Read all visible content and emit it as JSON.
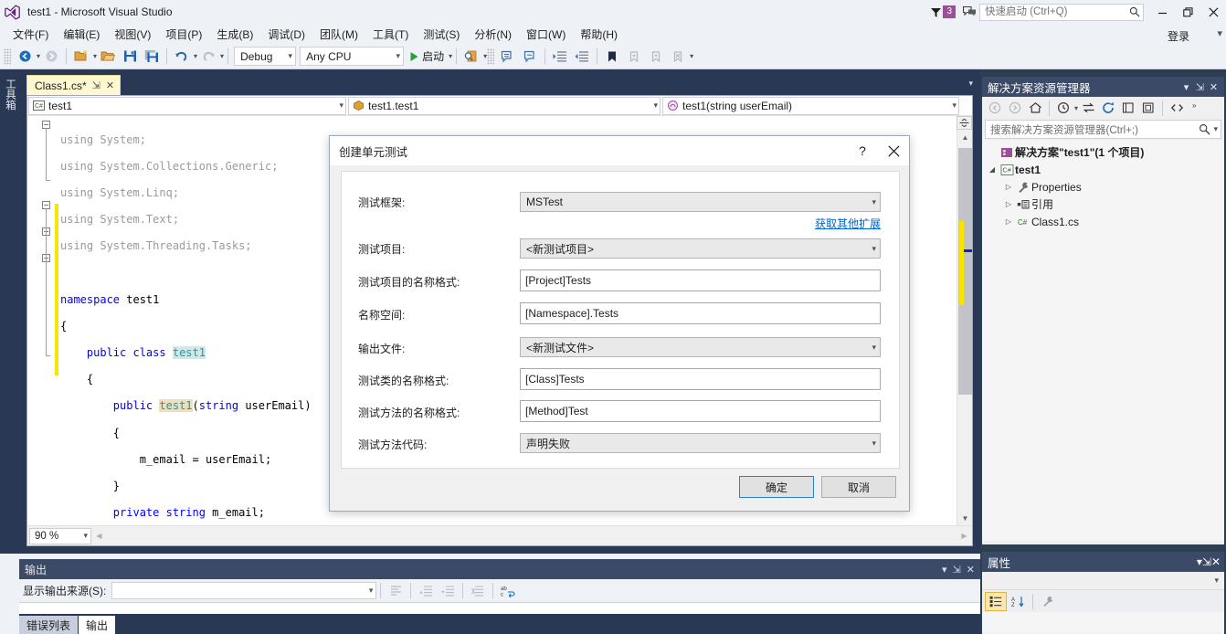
{
  "titlebar": {
    "title": "test1 - Microsoft Visual Studio",
    "logo_icon": "visual-studio-logo-icon",
    "notification_count": "3",
    "notification_icon": "notification-flag-icon",
    "feedback_icon": "feedback-icon",
    "quick_launch_placeholder": "快速启动 (Ctrl+Q)",
    "quick_launch_value": "",
    "search_icon": "search-icon",
    "minimize_icon": "minimize-icon",
    "restore_icon": "restore-icon",
    "close_icon": "close-icon"
  },
  "menubar": {
    "items": [
      {
        "label": "文件(F)"
      },
      {
        "label": "编辑(E)"
      },
      {
        "label": "视图(V)"
      },
      {
        "label": "项目(P)"
      },
      {
        "label": "生成(B)"
      },
      {
        "label": "调试(D)"
      },
      {
        "label": "团队(M)"
      },
      {
        "label": "工具(T)"
      },
      {
        "label": "测试(S)"
      },
      {
        "label": "分析(N)"
      },
      {
        "label": "窗口(W)"
      },
      {
        "label": "帮助(H)"
      }
    ],
    "signin_label": "登录",
    "overflow_icon": "chevron-down-icon"
  },
  "toolbar": {
    "nav_back_icon": "navigate-back-icon",
    "nav_forward_icon": "navigate-forward-icon",
    "new_project_icon": "new-project-icon",
    "open_file_icon": "open-file-icon",
    "save_icon": "save-icon",
    "save_all_icon": "save-all-icon",
    "undo_icon": "undo-icon",
    "redo_icon": "redo-icon",
    "config_value": "Debug",
    "platform_value": "Any CPU",
    "start_label": "启动",
    "start_icon": "play-icon",
    "find_icon": "find-in-files-icon",
    "comment_icon": "comment-selection-icon",
    "uncomment_icon": "uncomment-selection-icon",
    "indent_icon": "increase-indent-icon",
    "outdent_icon": "decrease-indent-icon",
    "bookmark_icon": "bookmark-icon",
    "bookmark_prev_icon": "previous-bookmark-icon",
    "bookmark_next_icon": "next-bookmark-icon",
    "bookmark_clear_icon": "clear-bookmarks-icon",
    "overflow_icon": "toolbar-overflow-icon"
  },
  "left_dock": {
    "toolbox_label": "工具箱"
  },
  "editor": {
    "tab": {
      "label": "Class1.cs*",
      "pin_icon": "pin-icon",
      "close_icon": "close-icon"
    },
    "nav": {
      "project_icon": "csharp-file-icon",
      "project_value": "test1",
      "type_icon": "class-icon",
      "type_value": "test1.test1",
      "member_icon": "method-icon",
      "member_value": "test1(string userEmail)"
    },
    "code_lines": [
      "using System;",
      "using System.Collections.Generic;",
      "using System.Linq;",
      "using System.Text;",
      "using System.Threading.Tasks;",
      "",
      "namespace test1",
      "{",
      "    public class test1",
      "    {",
      "        public test1(string userEmail)",
      "        {",
      "            m_email = userEmail;",
      "        }",
      "        private string m_email;",
      "",
      "    }",
      "}"
    ],
    "zoom_level": "90 %"
  },
  "output_panel": {
    "title": "输出",
    "dropdown_icon": "chevron-down-icon",
    "pin_icon": "pin-icon",
    "close_icon": "close-icon",
    "source_label": "显示输出来源(S):",
    "source_value": "",
    "find_message_icon": "find-message-icon",
    "go_prev_icon": "go-to-previous-message-icon",
    "go_next_icon": "go-to-next-message-icon",
    "clear_icon": "clear-all-icon",
    "wordwrap_icon": "toggle-word-wrap-icon",
    "tabs": [
      {
        "label": "错误列表",
        "active": false
      },
      {
        "label": "输出",
        "active": true
      }
    ]
  },
  "solution_explorer": {
    "title": "解决方案资源管理器",
    "dropdown_icon": "chevron-down-icon",
    "pin_icon": "pin-icon",
    "close_icon": "close-icon",
    "toolbar": {
      "back_icon": "back-icon",
      "forward_icon": "forward-icon",
      "home_icon": "home-icon",
      "pending_changes_icon": "pending-changes-icon",
      "sync_icon": "sync-with-active-document-icon",
      "refresh_icon": "refresh-icon",
      "collapse_icon": "collapse-all-icon",
      "show_all_icon": "show-all-files-icon",
      "code_view_icon": "view-code-icon",
      "overflow_icon": "overflow-icon"
    },
    "search_placeholder": "搜索解决方案资源管理器(Ctrl+;)",
    "search_value": "",
    "search_icon": "search-icon",
    "tree": [
      {
        "label": "解决方案\"test1\"(1 个项目)",
        "icon": "solution-icon",
        "indent": 0,
        "expander": "",
        "bold": true
      },
      {
        "label": "test1",
        "icon": "csharp-project-icon",
        "indent": 1,
        "expander": "expanded",
        "bold": true
      },
      {
        "label": "Properties",
        "icon": "properties-wrench-icon",
        "indent": 2,
        "expander": "collapsed",
        "bold": false
      },
      {
        "label": "引用",
        "icon": "references-icon",
        "indent": 2,
        "expander": "collapsed",
        "bold": false
      },
      {
        "label": "Class1.cs",
        "icon": "csharp-file-icon",
        "indent": 2,
        "expander": "collapsed",
        "bold": false
      }
    ]
  },
  "properties_panel": {
    "title": "属性",
    "dropdown_icon": "chevron-down-icon",
    "pin_icon": "pin-icon",
    "close_icon": "close-icon",
    "object_select_value": "",
    "categorized_icon": "categorized-view-icon",
    "alphabetical_icon": "alphabetical-sort-icon",
    "properties_icon": "properties-wrench-icon"
  },
  "dialog": {
    "title": "创建单元测试",
    "help_icon": "help-icon",
    "close_icon": "close-icon",
    "fields": [
      {
        "label": "测试框架:",
        "value": "MSTest",
        "type": "select",
        "name": "test-framework"
      },
      {
        "label": "测试项目:",
        "value": "<新测试项目>",
        "type": "select",
        "name": "test-project"
      },
      {
        "label": "测试项目的名称格式:",
        "value": "[Project]Tests",
        "type": "input",
        "name": "test-project-name-format"
      },
      {
        "label": "名称空间:",
        "value": "[Namespace].Tests",
        "type": "input",
        "name": "namespace"
      },
      {
        "label": "输出文件:",
        "value": "<新测试文件>",
        "type": "select",
        "name": "output-file"
      },
      {
        "label": "测试类的名称格式:",
        "value": "[Class]Tests",
        "type": "input",
        "name": "test-class-name-format"
      },
      {
        "label": "测试方法的名称格式:",
        "value": "[Method]Test",
        "type": "input",
        "name": "test-method-name-format"
      },
      {
        "label": "测试方法代码:",
        "value": "声明失败",
        "type": "select",
        "name": "test-method-code"
      }
    ],
    "extensions_link": "获取其他扩展",
    "ok_label": "确定",
    "cancel_label": "取消"
  },
  "colors": {
    "vs_blue": "#293955",
    "panel_header": "#3b4a66",
    "chrome": "#eef1f6",
    "accent_link": "#0066cc",
    "keyword": "#0000ff",
    "type": "#2b91af",
    "change_bar": "#f7e400",
    "tab_active": "#fff8d0",
    "badge_purple": "#9b4f96"
  }
}
